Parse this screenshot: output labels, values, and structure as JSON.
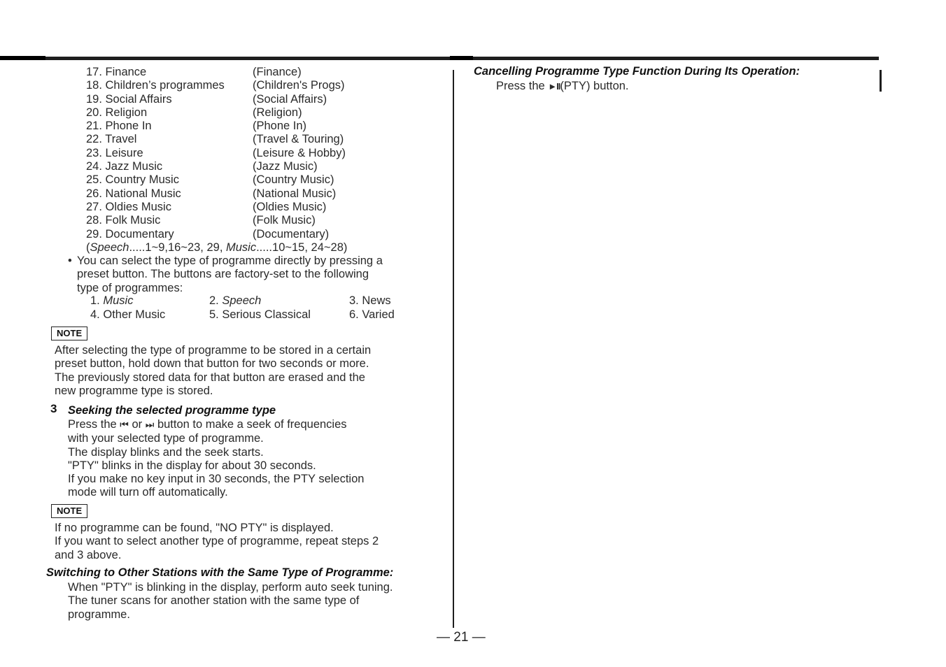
{
  "pty_list": [
    {
      "name": "17. Finance",
      "code": "(Finance)"
    },
    {
      "name": "18. Children’s programmes",
      "code": "(Children's Progs)"
    },
    {
      "name": "19. Social Affairs",
      "code": "(Social Affairs)"
    },
    {
      "name": "20. Religion",
      "code": "(Religion)"
    },
    {
      "name": "21. Phone In",
      "code": "(Phone In)"
    },
    {
      "name": "22. Travel",
      "code": "(Travel & Touring)"
    },
    {
      "name": "23. Leisure",
      "code": "(Leisure & Hobby)"
    },
    {
      "name": "24. Jazz Music",
      "code": "(Jazz Music)"
    },
    {
      "name": "25. Country Music",
      "code": "(Country Music)"
    },
    {
      "name": "26. National Music",
      "code": "(National Music)"
    },
    {
      "name": "27. Oldies Music",
      "code": "(Oldies Music)"
    },
    {
      "name": "28. Folk Music",
      "code": "(Folk Music)"
    },
    {
      "name": "29. Documentary",
      "code": "(Documentary)"
    }
  ],
  "category_note": {
    "open": "(",
    "speech_label": "Speech",
    "speech_range": ".....1~9,16~23, 29, ",
    "music_label": "Music",
    "music_range": ".....10~15, 24~28)"
  },
  "bullet": {
    "symbol": "•",
    "lines": [
      "You can select the type of programme directly by pressing a",
      "preset button. The buttons are factory-set to the following",
      "type of programmes:"
    ]
  },
  "presets": [
    {
      "num": "1. ",
      "label": "Music",
      "italic": true
    },
    {
      "num": "2. ",
      "label": "Speech",
      "italic": true
    },
    {
      "num": "3. ",
      "label": "News",
      "italic": false
    },
    {
      "num": "4. ",
      "label": "Other Music",
      "italic": false
    },
    {
      "num": "5. ",
      "label": "Serious Classical",
      "italic": false
    },
    {
      "num": "6. ",
      "label": "Varied",
      "italic": false
    }
  ],
  "note1": {
    "badge": "NOTE",
    "lines": [
      "After selecting the type of programme to be stored in a certain",
      "preset button, hold down that button for two seconds or more.",
      "The previously stored data for that button are erased and the",
      "new programme type is stored."
    ]
  },
  "step3": {
    "number": "3",
    "heading": "Seeking the selected programme type",
    "line1_pre": "Press the ",
    "prev_icon": "⏮",
    "line1_mid": " or ",
    "next_icon": "⏭",
    "line1_post": " button to make a seek of frequencies",
    "lines": [
      "with your selected type of programme.",
      "The display blinks and the seek starts.",
      "\"PTY\" blinks in the display for about 30 seconds.",
      "If you make no key input in 30 seconds, the PTY selection",
      "mode will turn off automatically."
    ]
  },
  "note2": {
    "badge": "NOTE",
    "lines": [
      "If no programme can be found, \"NO PTY\" is displayed.",
      "If you want to select another type of programme, repeat steps 2",
      "and 3 above."
    ]
  },
  "switching": {
    "heading": "Switching to Other Stations with the Same Type of Programme:",
    "lines": [
      "When \"PTY\" is blinking in the display, perform auto seek tuning.",
      "The tuner scans for another station with the same type of",
      "programme."
    ]
  },
  "cancelling": {
    "heading": "Cancelling Programme Type Function During Its Operation:",
    "pre": "Press the ",
    "icon": "►II",
    "post": "(PTY) button."
  },
  "page_number": "— 21 —"
}
